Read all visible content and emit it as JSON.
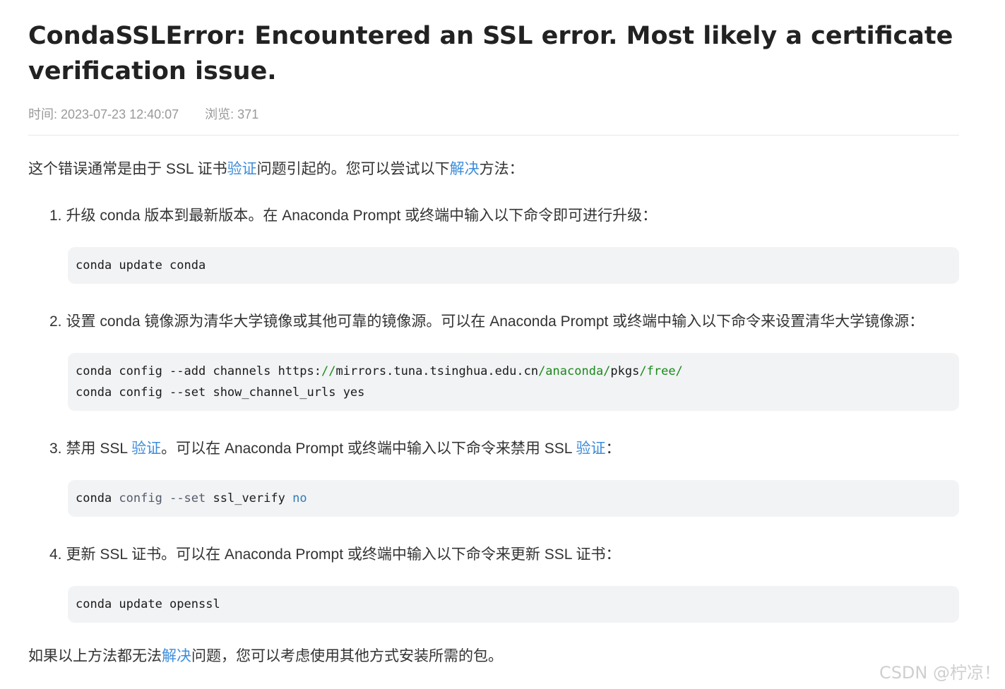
{
  "article": {
    "title": "CondaSSLError: Encountered an SSL error. Most likely a certificate verification issue.",
    "meta": {
      "time": "时间: 2023-07-23 12:40:07",
      "views": "浏览: 371"
    },
    "intro": {
      "part1": "这个错误通常是由于 SSL 证书",
      "link1": "验证",
      "part2": "问题引起的。您可以尝试以下",
      "link2": "解决",
      "part3": "方法："
    },
    "steps": [
      {
        "number": "1.",
        "text": "升级 conda 版本到最新版本。在 Anaconda Prompt 或终端中输入以下命令即可进行升级：",
        "code": "conda update conda"
      },
      {
        "number": "2.",
        "text": "设置 conda 镜像源为清华大学镜像或其他可靠的镜像源。可以在 Anaconda Prompt 或终端中输入以下命令来设置清华大学镜像源：",
        "code_line1": {
          "t1": "conda config --add channels https:",
          "t2": "//",
          "t3": "mirrors.tuna.tsinghua.edu.cn",
          "t4": "/anaconda/",
          "t5": "pkgs",
          "t6": "/free/"
        },
        "code_line2": "conda config --set show_channel_urls yes"
      },
      {
        "number": "3.",
        "text_part1": "禁用 SSL ",
        "link1": "验证",
        "text_part2": "。可以在 Anaconda Prompt 或终端中输入以下命令来禁用 SSL ",
        "link2": "验证",
        "text_part3": "：",
        "code": {
          "t1": "conda ",
          "t2": "config",
          "t3": " --set ",
          "t4": "ssl_verify",
          "t5": " ",
          "t6": "no"
        }
      },
      {
        "number": "4.",
        "text": "更新 SSL 证书。可以在 Anaconda Prompt 或终端中输入以下命令来更新 SSL 证书：",
        "code": "conda update openssl"
      }
    ],
    "outro": {
      "part1": "如果以上方法都无法",
      "link": "解决",
      "part2": "问题，您可以考虑使用其他方式安装所需的包。"
    }
  },
  "watermark": "CSDN @柠凉！",
  "colors": {
    "link": "#3d8ddb",
    "code_bg": "#f2f3f5",
    "code_green": "#1a8a1a",
    "code_blue": "#2e7bb8"
  }
}
